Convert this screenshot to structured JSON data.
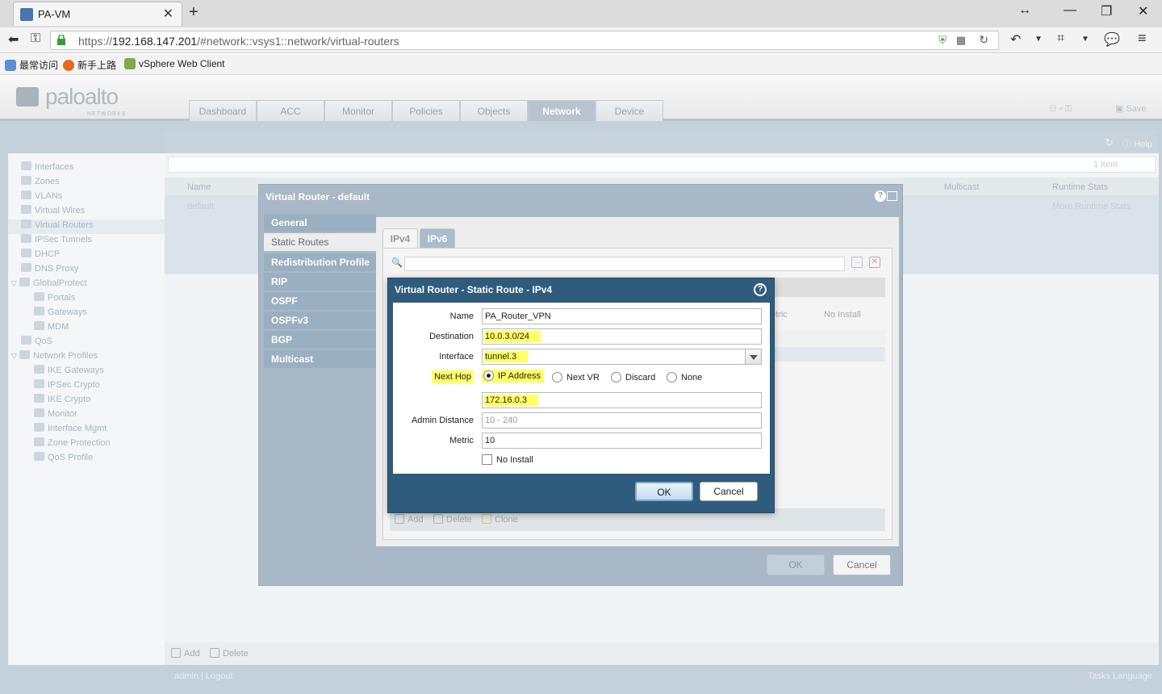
{
  "browser": {
    "tab_title": "PA-VM",
    "url_prefix": "https://",
    "url_host": "192.168.147.201",
    "url_path": "/#network::vsys1::network/virtual-routers",
    "bookmarks": [
      "最常访问",
      "新手上路",
      "vSphere Web Client"
    ]
  },
  "app": {
    "logo_text": "paloalto",
    "logo_sub": "NETWORKS",
    "tabs": [
      "Dashboard",
      "ACC",
      "Monitor",
      "Policies",
      "Objects",
      "Network",
      "Device"
    ],
    "active_tab": "Network",
    "save_label": "Save",
    "help_label": "Help",
    "items_count": "1 item"
  },
  "sidebar": {
    "items": [
      "Interfaces",
      "Zones",
      "VLANs",
      "Virtual Wires",
      "Virtual Routers",
      "IPSec Tunnels",
      "DHCP",
      "DNS Proxy",
      "GlobalProtect",
      "Portals",
      "Gateways",
      "MDM",
      "QoS",
      "Network Profiles",
      "IKE Gateways",
      "IPSec Crypto",
      "IKE Crypto",
      "Monitor",
      "Interface Mgmt",
      "Zone Protection",
      "QoS Profile"
    ]
  },
  "main": {
    "col_name": "Name",
    "col_multicast": "Multicast",
    "col_runtime": "Runtime Stats",
    "row_name": "default",
    "row_runtime": "More Runtime Stats",
    "add_label": "Add",
    "delete_label": "Delete",
    "status_left": "admin | Logout",
    "status_right": "Tasks  Language"
  },
  "outer_dialog": {
    "title": "Virtual Router - default",
    "side_tabs": [
      "General",
      "Static Routes",
      "Redistribution Profile",
      "RIP",
      "OSPF",
      "OSPFv3",
      "BGP",
      "Multicast"
    ],
    "active_side_tab": "Static Routes",
    "ip_tabs": [
      "IPv4",
      "IPv6"
    ],
    "col_metric": "etric",
    "col_noinstall": "No Install",
    "add_label": "Add",
    "delete_label": "Delete",
    "clone_label": "Clone",
    "ok_label": "OK",
    "cancel_label": "Cancel"
  },
  "modal": {
    "title": "Virtual Router - Static Route - IPv4",
    "name_label": "Name",
    "name_value": "PA_Router_VPN",
    "destination_label": "Destination",
    "destination_value": "10.0.3.0/24",
    "interface_label": "Interface",
    "interface_value": "tunnel.3",
    "nexthop_label": "Next Hop",
    "nexthop_options": [
      "IP Address",
      "Next VR",
      "Discard",
      "None"
    ],
    "nexthop_selected": "IP Address",
    "nexthop_value": "172.16.0.3",
    "admin_distance_label": "Admin Distance",
    "admin_distance_placeholder": "10 - 240",
    "metric_label": "Metric",
    "metric_value": "10",
    "no_install_label": "No Install",
    "ok_label": "OK",
    "cancel_label": "Cancel"
  }
}
